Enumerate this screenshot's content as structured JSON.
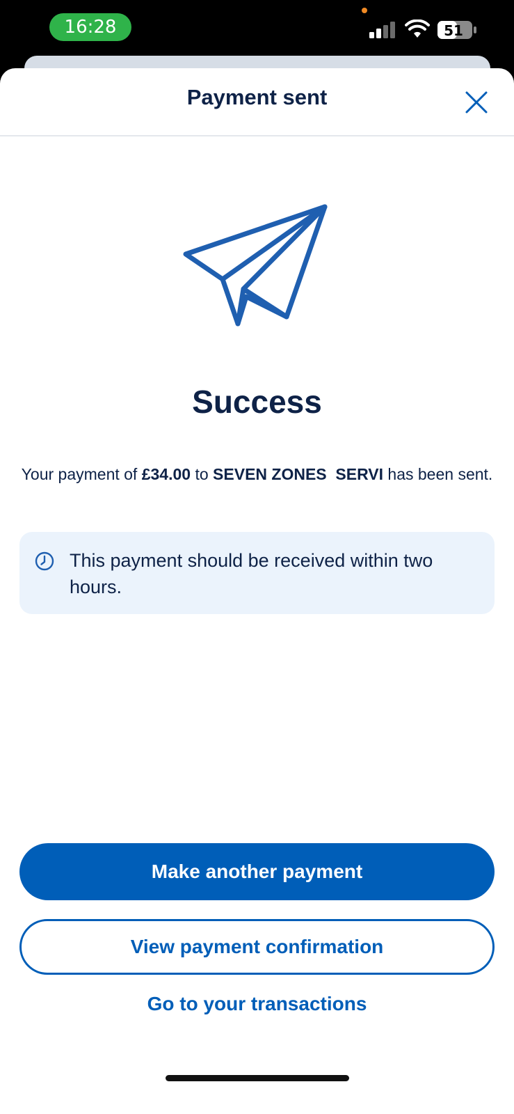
{
  "status_bar": {
    "time": "16:28",
    "battery": "51",
    "icons": [
      "signal-icon",
      "wifi-icon",
      "battery-icon"
    ]
  },
  "header": {
    "title": "Payment sent",
    "close_icon": "close-icon"
  },
  "hero": {
    "icon": "paper-plane-icon",
    "title": "Success"
  },
  "message": {
    "prefix": "Your payment of ",
    "amount": "£34.00",
    "middle": " to ",
    "payee": "SEVEN ZONES  SERVI",
    "suffix": " has been sent."
  },
  "info": {
    "icon": "clock-icon",
    "text": "This payment should be received within two hours."
  },
  "actions": {
    "primary": "Make another payment",
    "secondary": "View payment confirmation",
    "link": "Go to your transactions"
  },
  "colors": {
    "brand_blue": "#005eb8",
    "text_navy": "#0e2247",
    "info_bg": "#ebf3fc",
    "time_pill": "#2fb34a"
  }
}
